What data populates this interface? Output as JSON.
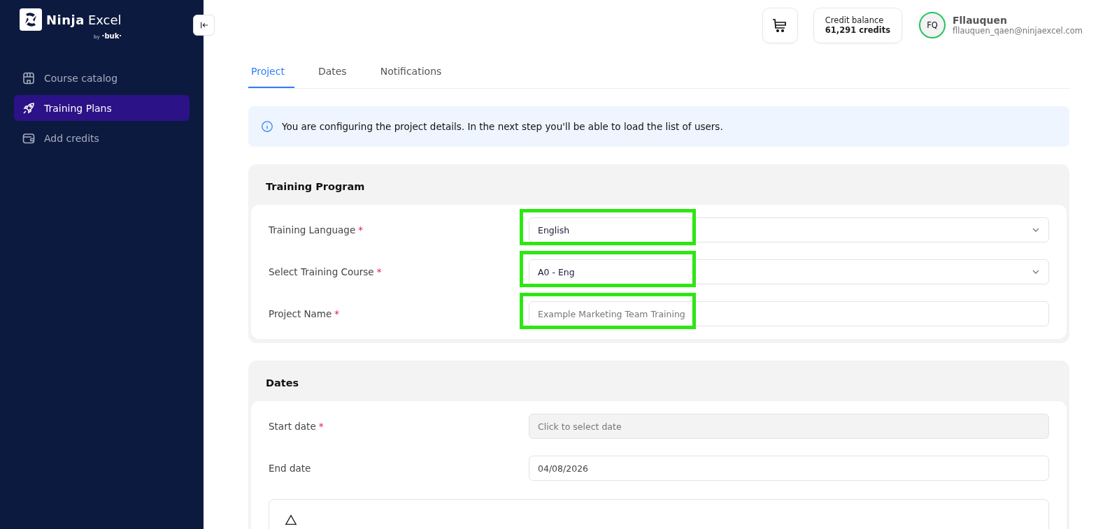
{
  "sidebar": {
    "logo": {
      "name": "Ninja",
      "suffix": "Excel",
      "by": "by",
      "brand": "·buk·"
    },
    "items": [
      {
        "label": "Course catalog",
        "selected": false
      },
      {
        "label": "Training Plans",
        "selected": true
      },
      {
        "label": "Add credits",
        "selected": false
      }
    ]
  },
  "header": {
    "credit": {
      "label": "Credit balance",
      "value": "61,291 credits"
    },
    "user": {
      "initials": "FQ",
      "name": "Fllauquen",
      "email": "fllauquen_qaen@ninjaexcel.com"
    }
  },
  "tabs": [
    {
      "label": "Project",
      "selected": true
    },
    {
      "label": "Dates",
      "selected": false
    },
    {
      "label": "Notifications",
      "selected": false
    }
  ],
  "info": "You are configuring the project details. In the next step you'll be able to load the list of users.",
  "sections": [
    {
      "title": "Training Program",
      "notice": false,
      "fields": [
        {
          "label": "Training Language",
          "required": "*",
          "kind": "select",
          "value": "English",
          "highlighted": true
        },
        {
          "label": "Select Training Course",
          "required": "*",
          "kind": "select",
          "value": "A0 - Eng",
          "highlighted": true
        },
        {
          "label": "Project Name",
          "required": "*",
          "kind": "text",
          "placeholder": "Example Marketing Team Training",
          "highlighted": true
        }
      ]
    },
    {
      "title": "Dates",
      "notice": true,
      "fields": [
        {
          "label": "Start date",
          "required": "*",
          "kind": "date",
          "placeholder": "Click to select date",
          "disabled": true,
          "highlighted": false
        },
        {
          "label": "End date",
          "kind": "date",
          "value": "04/08/2026",
          "disabled": false,
          "highlighted": false
        }
      ]
    }
  ]
}
